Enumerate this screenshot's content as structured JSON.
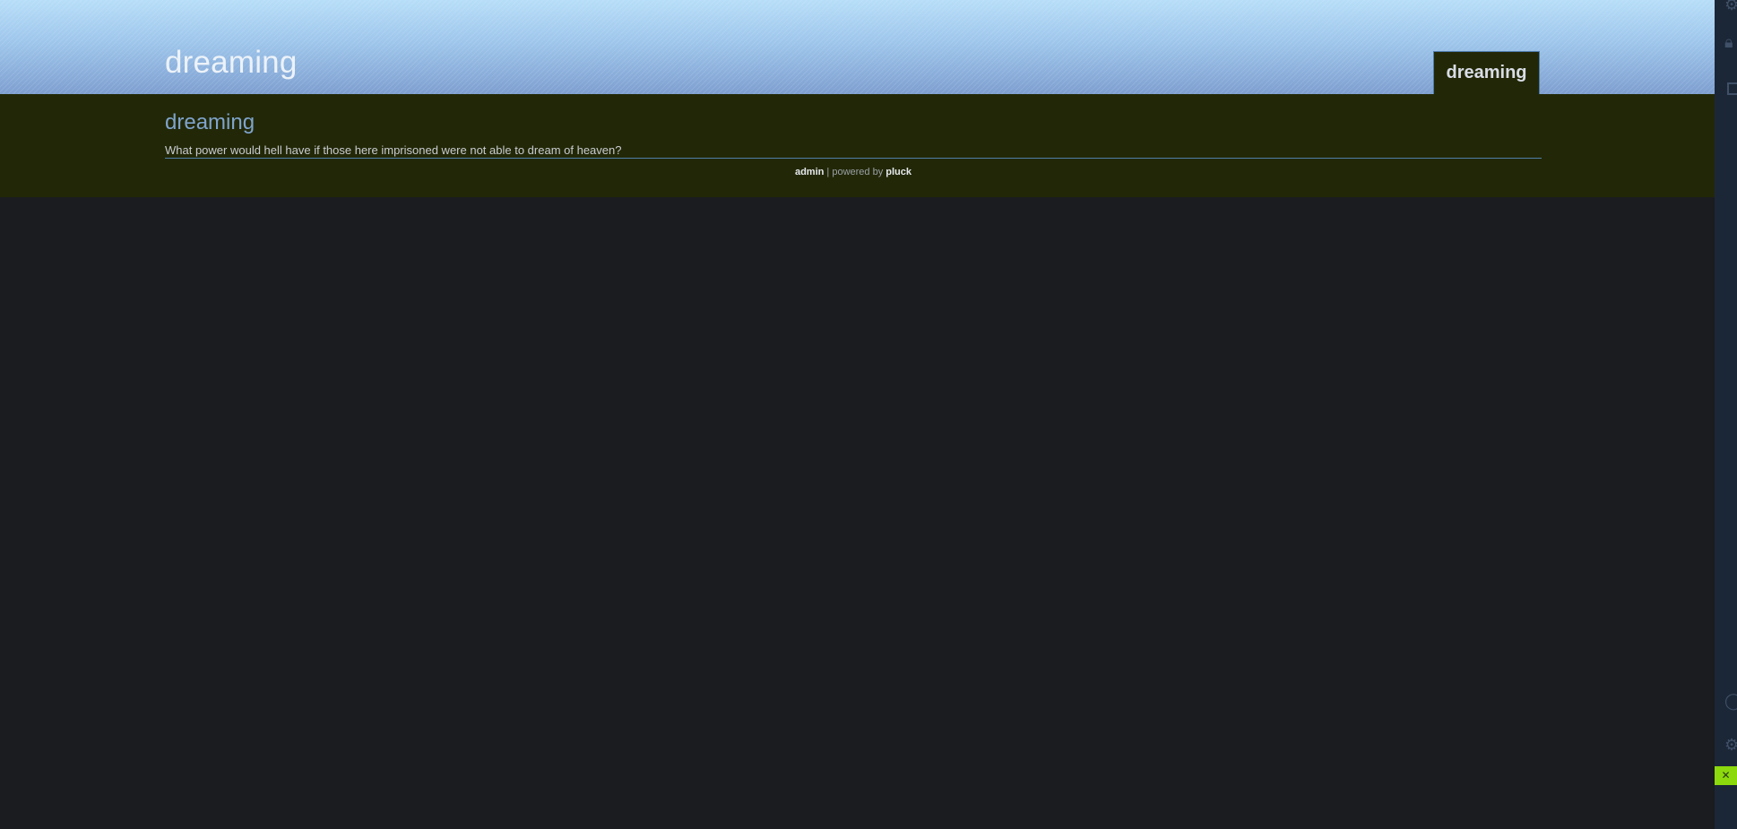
{
  "site": {
    "title": "dreaming"
  },
  "nav": {
    "items": [
      {
        "label": "dreaming"
      }
    ]
  },
  "page": {
    "heading": "dreaming",
    "text": "What power would hell have if those here imprisoned were not able to dream of heaven?"
  },
  "footer": {
    "admin_link": "admin",
    "separator": " | powered by ",
    "pluck_link": "pluck"
  },
  "side_rail": {
    "icons": [
      "settings-icon",
      "lock-icon",
      "layout-icon",
      "user-icon",
      "gear-icon",
      "close-icon"
    ]
  },
  "colors": {
    "header_gradient_top": "#b7def8",
    "header_gradient_bottom": "#7e9fd0",
    "content_background": "#222807",
    "page_background": "#1b1c1f",
    "heading": "#7fa4cc",
    "accent_line": "#4f7ea8",
    "rail_background": "#1b2737",
    "rail_green": "#8cd90d"
  }
}
